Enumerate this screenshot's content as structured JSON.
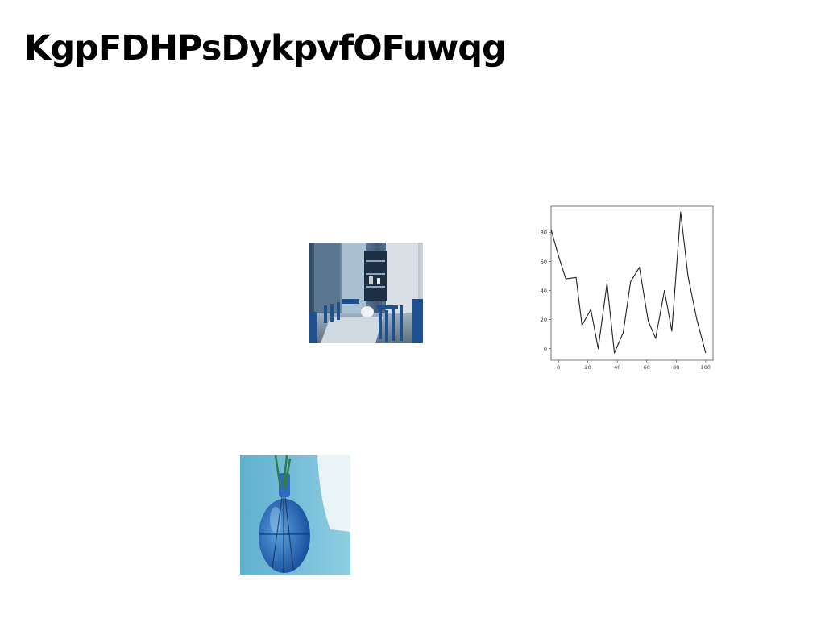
{
  "page": {
    "title": "KgpFDHPsDykpvfOFuwqg"
  },
  "images": [
    {
      "name": "cafe-interior-photo",
      "subject": "blue-toned cafe interior with chairs and tables"
    },
    {
      "name": "vase-photo",
      "subject": "blue glass vase with green stems"
    }
  ],
  "chart_data": {
    "type": "line",
    "title": "",
    "xlabel": "",
    "ylabel": "",
    "xlim": [
      -5,
      105
    ],
    "ylim": [
      -8,
      98
    ],
    "xticks": [
      0,
      20,
      40,
      60,
      80,
      100
    ],
    "yticks": [
      0,
      20,
      40,
      60,
      80
    ],
    "grid": false,
    "series": [
      {
        "color": "#222222",
        "x": [
          -5,
          0,
          5,
          12,
          16,
          22,
          27,
          33,
          38,
          44,
          49,
          55,
          61,
          66,
          72,
          77,
          83,
          88,
          94,
          100
        ],
        "y": [
          82,
          64,
          48,
          49,
          16,
          27,
          0,
          45,
          -3,
          11,
          46,
          56,
          19,
          7,
          40,
          12,
          94,
          50,
          20,
          -3
        ]
      }
    ]
  }
}
